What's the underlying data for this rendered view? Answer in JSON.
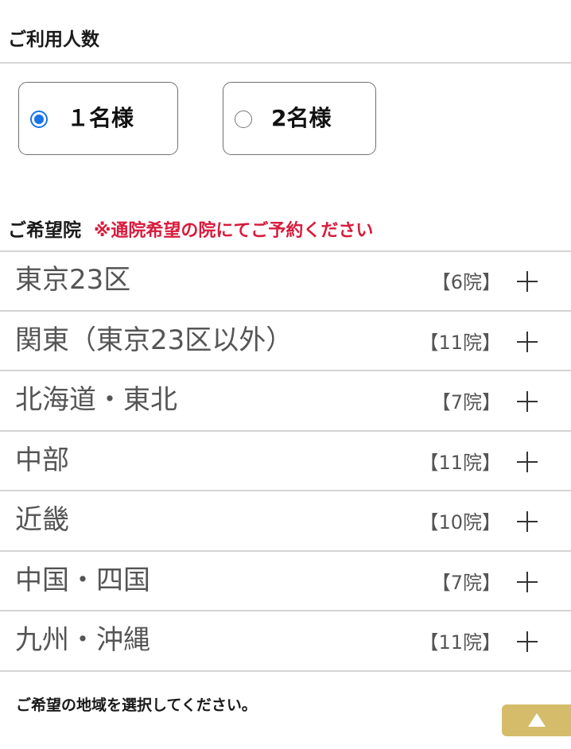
{
  "people_section": {
    "title": "ご利用人数",
    "options": [
      {
        "label": "１名様",
        "checked": true
      },
      {
        "label": "2名様",
        "checked": false
      }
    ]
  },
  "clinic_section": {
    "title": "ご希望院",
    "note": "※通院希望の院にてご予約ください",
    "regions": [
      {
        "name": "東京23区",
        "count": "【6院】"
      },
      {
        "name": "関東（東京23区以外）",
        "count": "【11院】"
      },
      {
        "name": "北海道・東北",
        "count": "【7院】"
      },
      {
        "name": "中部",
        "count": "【11院】"
      },
      {
        "name": "近畿",
        "count": "【10院】"
      },
      {
        "name": "中国・四国",
        "count": "【7院】"
      },
      {
        "name": "九州・沖縄",
        "count": "【11院】"
      }
    ]
  },
  "footer": {
    "note": "ご希望の地域を選択してください。",
    "scroll_top_icon": "triangle-up-icon"
  },
  "colors": {
    "accent_blue": "#1a73e8",
    "note_red": "#d81b3c",
    "scroll_button_gold": "#d4bc6a"
  }
}
